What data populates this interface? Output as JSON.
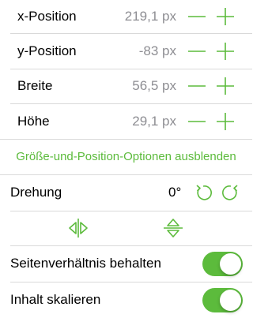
{
  "colors": {
    "accent": "#5cbb3c",
    "secondary_text": "#8e8e93",
    "separator": "#d9d9d9"
  },
  "fields": [
    {
      "label": "x-Position",
      "value": "219,1 px"
    },
    {
      "label": "y-Position",
      "value": "-83 px"
    },
    {
      "label": "Breite",
      "value": "56,5 px"
    },
    {
      "label": "Höhe",
      "value": "29,1 px"
    }
  ],
  "options_link": "Größe-und-Position-Optionen ausblenden",
  "rotation": {
    "label": "Drehung",
    "value": "0°"
  },
  "toggles": [
    {
      "label": "Seitenverhältnis behalten",
      "on": true
    },
    {
      "label": "Inhalt skalieren",
      "on": true
    }
  ]
}
